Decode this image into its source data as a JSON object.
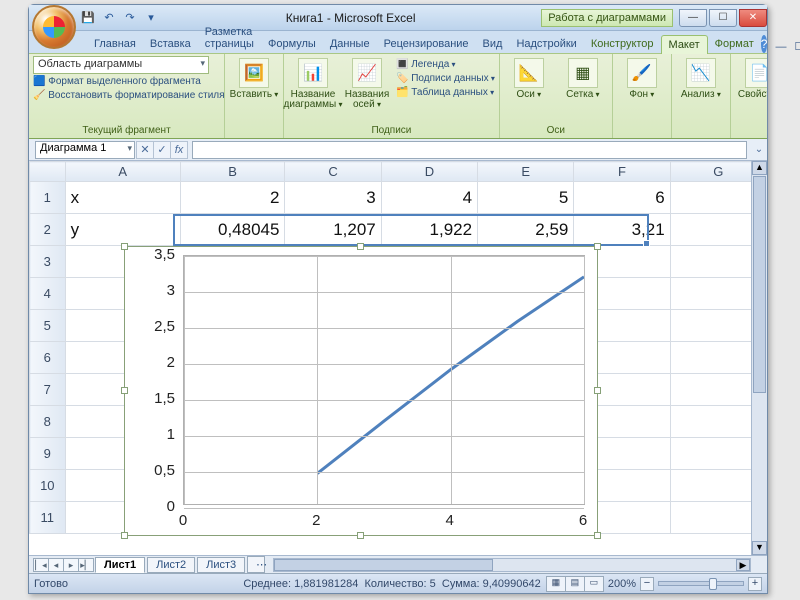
{
  "titlebar": {
    "doc_title": "Книга1 - Microsoft Excel",
    "tool_context": "Работа с диаграммами"
  },
  "qat": {
    "save": "💾",
    "undo": "↶",
    "redo": "↷",
    "custom": "▾"
  },
  "winbtns": {
    "min": "—",
    "max": "☐",
    "close": "✕"
  },
  "tabs": {
    "items": [
      "Главная",
      "Вставка",
      "Разметка страницы",
      "Формулы",
      "Данные",
      "Рецензирование",
      "Вид",
      "Надстройки"
    ],
    "tool_tabs": [
      "Конструктор",
      "Макет",
      "Формат"
    ],
    "active": "Макет",
    "doc_min": "—",
    "doc_close": "✕",
    "help": "?"
  },
  "ribbon": {
    "g1": {
      "name": "Текущий фрагмент",
      "selbox": "Область диаграммы",
      "a": "Формат выделенного фрагмента",
      "b": "Восстановить форматирование стиля"
    },
    "g2": {
      "name": " ",
      "insert": "Вставить"
    },
    "g3": {
      "name": "Подписи",
      "chart_title": "Название\nдиаграммы",
      "axis_title": "Названия\nосей",
      "legend": "Легенда",
      "data_labels": "Подписи данных",
      "data_table": "Таблица данных"
    },
    "g4": {
      "name": "Оси",
      "axes": "Оси",
      "grid": "Сетка"
    },
    "g5": {
      "name": " ",
      "bg": "Фон"
    },
    "g6": {
      "name": " ",
      "analysis": "Анализ"
    },
    "g7": {
      "name": " ",
      "props": "Свойства"
    }
  },
  "fbar": {
    "name": "Диаграмма 1",
    "fx": "fx",
    "x": "✕",
    "v": "✓"
  },
  "columns": [
    "A",
    "B",
    "C",
    "D",
    "E",
    "F",
    "G"
  ],
  "rows": {
    "1": {
      "A": "x",
      "B": "2",
      "C": "3",
      "D": "4",
      "E": "5",
      "F": "6",
      "G": ""
    },
    "2": {
      "A": "y",
      "B": "0,48045",
      "C": "1,207",
      "D": "1,922",
      "E": "2,59",
      "F": "3,21",
      "G": ""
    }
  },
  "row_nums": [
    "1",
    "2",
    "3",
    "4",
    "5",
    "6",
    "7",
    "8",
    "9",
    "10",
    "11"
  ],
  "sheets": {
    "active": "Лист1",
    "others": [
      "Лист2",
      "Лист3"
    ],
    "add": "⋯"
  },
  "sheetnav": {
    "first": "▏◂",
    "prev": "◂",
    "next": "▸",
    "last": "▸▏"
  },
  "status": {
    "ready": "Готово",
    "avg_lbl": "Среднее:",
    "avg": "1,881981284",
    "cnt_lbl": "Количество:",
    "cnt": "5",
    "sum_lbl": "Сумма:",
    "sum": "9,40990642",
    "zoom": "200%"
  },
  "chart_data": {
    "type": "line",
    "x": [
      2,
      3,
      4,
      5,
      6
    ],
    "y": [
      0.48045,
      1.207,
      1.922,
      2.59,
      3.21
    ],
    "x_ticks": [
      0,
      2,
      4,
      6
    ],
    "y_ticks": [
      0,
      0.5,
      1,
      1.5,
      2,
      2.5,
      3,
      3.5
    ],
    "xlim": [
      0,
      6
    ],
    "ylim": [
      0,
      3.5
    ],
    "title": "",
    "xlabel": "",
    "ylabel": ""
  }
}
